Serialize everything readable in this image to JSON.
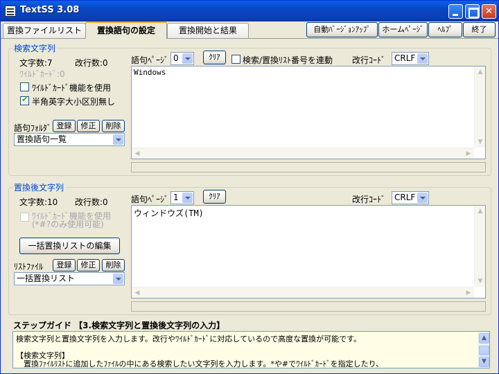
{
  "window": {
    "title": "TextSS 3.08"
  },
  "tabs": [
    {
      "label": "置換ファイルリスト"
    },
    {
      "label": "置換語句の設定"
    },
    {
      "label": "置換開始と結果"
    }
  ],
  "toolbar": {
    "auto_version_up": "自動ﾊﾞｰｼﾞｮﾝｱｯﾌﾟ",
    "homepage": "ホームﾍﾟｰｼﾞ",
    "help": "ﾍﾙﾌﾟ",
    "exit": "終了"
  },
  "search": {
    "legend": "検索文字列",
    "char_count": "文字数:7",
    "line_count": "改行数:0",
    "wildcard_count": "ﾜｲﾙﾄﾞｶｰﾄﾞ:0",
    "use_wildcard": "ﾜｲﾙﾄﾞｶｰﾄﾞ機能を使用",
    "case_insensitive": "半角英字大小区別無し",
    "folder_label": "語句ﾌｫﾙﾀﾞ",
    "register": "登録",
    "edit": "修正",
    "delete": "削除",
    "folder_value": "置換語句一覧",
    "page_label": "語句ﾍﾟｰｼﾞ",
    "page_value": "0",
    "clear": "ｸﾘｱ",
    "link_label": "検索/置換ﾘｽﾄ番号を連動",
    "newline_label": "改行ｺｰﾄﾞ",
    "newline_value": "CRLF",
    "text": "Windows"
  },
  "replace": {
    "legend": "置換後文字列",
    "char_count": "文字数:10",
    "line_count": "改行数:0",
    "use_wildcard": "ﾜｲﾙﾄﾞｶｰﾄﾞ機能を使用",
    "wildcard_note": "(*#?のみ使用可能)",
    "bulk_edit": "一括置換リストの編集",
    "list_label": "ﾘｽﾄﾌｧｲﾙ",
    "register": "登録",
    "edit": "修正",
    "delete": "削除",
    "list_value": "一括置換リスト",
    "page_label": "語句ﾍﾟｰｼﾞ",
    "page_value": "1",
    "clear": "ｸﾘｱ",
    "newline_label": "改行ｺｰﾄﾞ",
    "newline_value": "CRLF",
    "text": "ウィンドウズ(TM)"
  },
  "guide": {
    "title": "ステップガイド 【3.検索文字列と置換後文字列の入力】",
    "line1": "検索文字列と置換文字列を入力します。改行やﾜｲﾙﾄﾞｶｰﾄﾞに対応しているので高度な置換が可能です。",
    "line2": "",
    "line3": "【検索文字列】",
    "line4": "　置換ﾌｧｲﾙﾘｽﾄに追加したﾌｧｲﾙの中にある検索したい文字列を入力します。*や#でﾜｲﾙﾄﾞｶｰﾄﾞを指定したり、"
  }
}
